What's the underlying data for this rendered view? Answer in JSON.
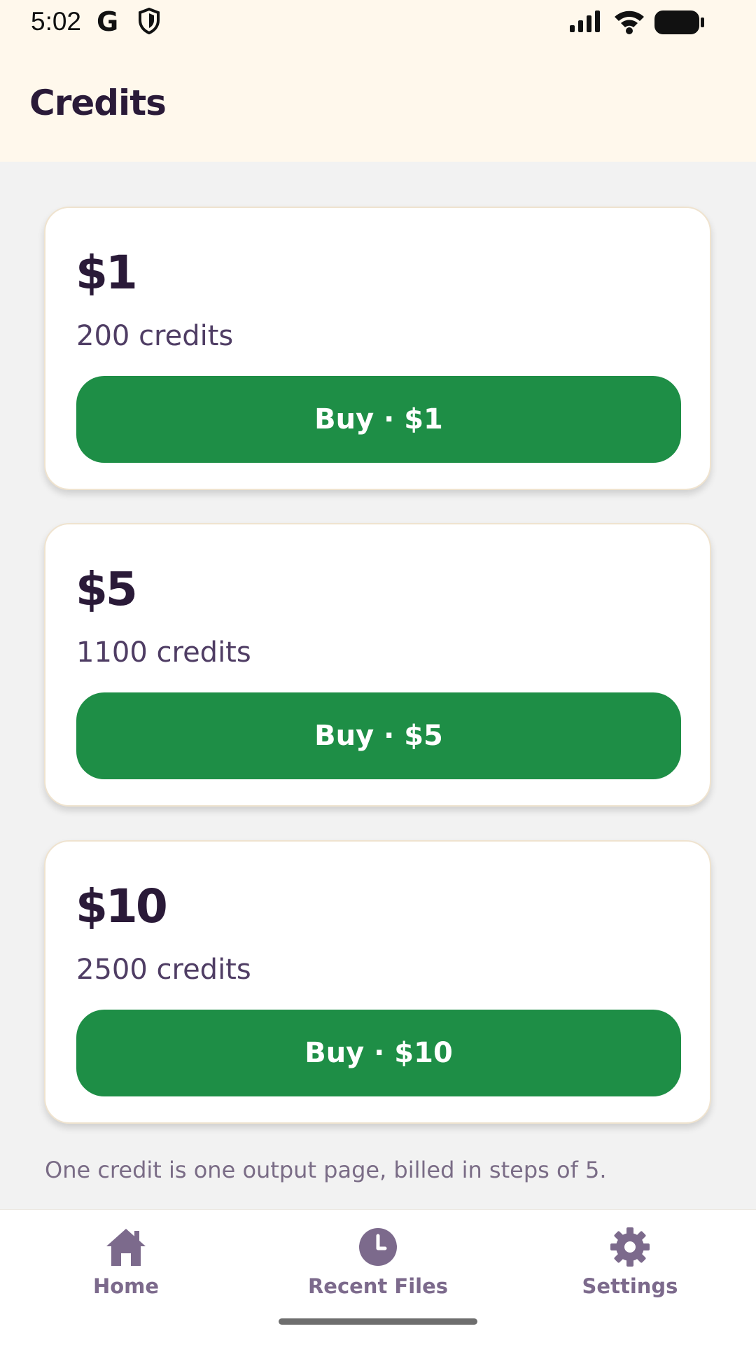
{
  "status_bar": {
    "time": "5:02",
    "icons": [
      "google-g-icon",
      "shield-icon",
      "signal-icon",
      "wifi-icon",
      "battery-icon"
    ]
  },
  "header": {
    "title": "Credits"
  },
  "packages": [
    {
      "price": "$1",
      "credits": "200 credits",
      "button_label": "Buy · $1"
    },
    {
      "price": "$5",
      "credits": "1100 credits",
      "button_label": "Buy · $5"
    },
    {
      "price": "$10",
      "credits": "2500 credits",
      "button_label": "Buy · $10"
    }
  ],
  "footnote": "One credit is one output page, billed in steps of 5.",
  "bottom_nav": {
    "items": [
      {
        "label": "Home",
        "icon": "home-icon"
      },
      {
        "label": "Recent Files",
        "icon": "clock-icon"
      },
      {
        "label": "Settings",
        "icon": "gear-icon"
      }
    ]
  },
  "colors": {
    "header_bg": "#fff8ec",
    "page_bg": "#f2f2f2",
    "button_green": "#1e8e46",
    "title_text": "#2a1a38",
    "nav_icon": "#7c6a8c"
  }
}
